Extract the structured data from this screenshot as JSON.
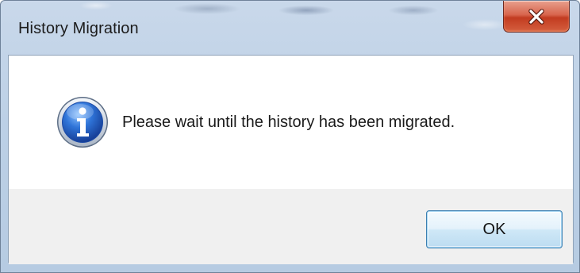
{
  "window": {
    "title": "History Migration",
    "close_icon": "close-icon"
  },
  "dialog": {
    "icon": "info-icon",
    "message": "Please wait until the history has been migrated.",
    "ok_label": "OK"
  },
  "colors": {
    "title_bar": "#bcd0e6",
    "close_button": "#c23b20",
    "content_background": "#ffffff",
    "button_area": "#f0f0f0",
    "ok_button_border": "#3c7fb1",
    "info_icon": "#1f5fbf"
  }
}
